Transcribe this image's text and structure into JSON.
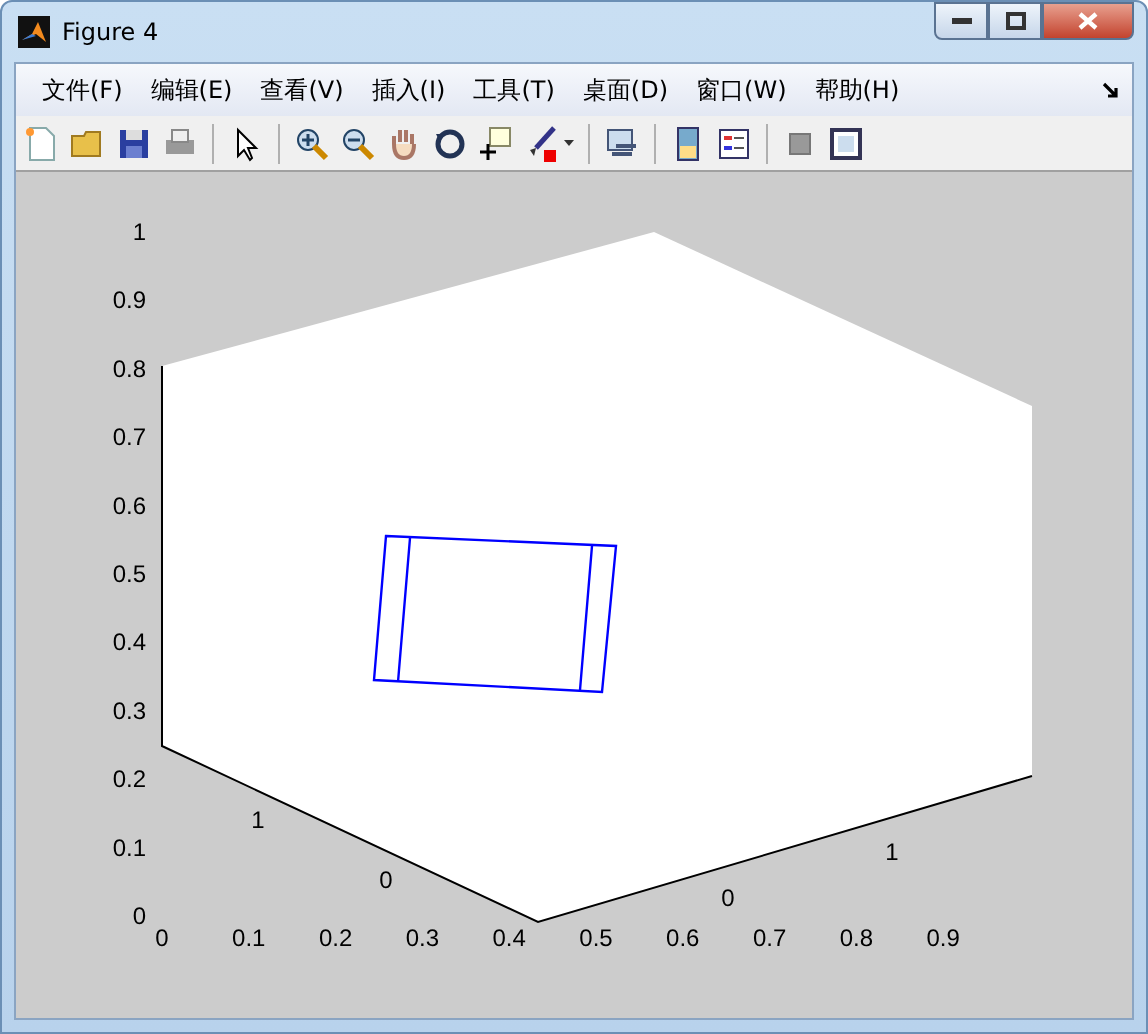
{
  "window": {
    "title": "Figure 4"
  },
  "menu": [
    "文件(F)",
    "编辑(E)",
    "查看(V)",
    "插入(I)",
    "工具(T)",
    "桌面(D)",
    "窗口(W)",
    "帮助(H)"
  ],
  "plot": {
    "z_ticks": [
      "1",
      "0.9",
      "0.8",
      "0.7",
      "0.6",
      "0.5",
      "0.4",
      "0.3",
      "0.2",
      "0.1",
      "0"
    ],
    "x_ticks": [
      "0",
      "0.1",
      "0.2",
      "0.3",
      "0.4",
      "0.5",
      "0.6",
      "0.7",
      "0.8",
      "0.9"
    ],
    "left_axis_ticks": [
      "1",
      "0"
    ],
    "right_axis_ticks": [
      "0",
      "1"
    ]
  }
}
